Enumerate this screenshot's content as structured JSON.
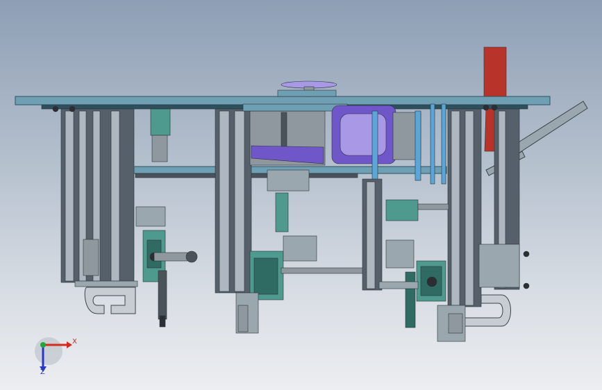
{
  "viewport": {
    "background_top": "#8e9fb5",
    "background_bottom": "#eceef1"
  },
  "model": {
    "colors": {
      "plate": "#6f9fb3",
      "plate_edge": "#2e4f5e",
      "column_light": "#aeb6bf",
      "column_dark": "#56606b",
      "teal_block": "#4f9a8e",
      "teal_dark": "#2f6b63",
      "steel": "#8f989f",
      "dark_steel": "#4a525a",
      "purple": "#6f56c9",
      "purple_light": "#a898e6",
      "blue_rod": "#5aa6d8",
      "red_plate": "#b8342a",
      "bracket": "#9aa7ae",
      "bolt": "#2b2f33"
    }
  },
  "triad": {
    "x_label": "X",
    "z_label": "Z",
    "x_color": "#d42a1f",
    "y_color": "#20a83a",
    "z_color": "#2836c8"
  }
}
